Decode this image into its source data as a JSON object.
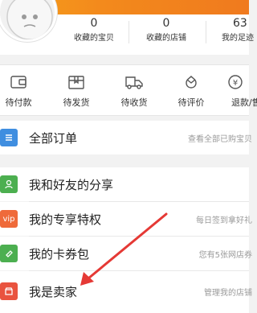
{
  "stats": [
    {
      "value": "0",
      "label": "收藏的宝贝"
    },
    {
      "value": "0",
      "label": "收藏的店铺"
    },
    {
      "value": "63",
      "label": "我的足迹"
    }
  ],
  "orders": [
    {
      "label": "待付款",
      "icon": "wallet-icon"
    },
    {
      "label": "待发货",
      "icon": "package-icon"
    },
    {
      "label": "待收货",
      "icon": "truck-icon"
    },
    {
      "label": "待评价",
      "icon": "review-icon"
    },
    {
      "label": "退款/售后",
      "icon": "refund-icon"
    }
  ],
  "all_orders": {
    "title": "全部订单",
    "hint": "查看全部已购宝贝"
  },
  "menu": [
    {
      "title": "我和好友的分享",
      "hint": "",
      "badge": "",
      "color": "#4caf50"
    },
    {
      "title": "我的专享特权",
      "hint": "每日签到拿好礼",
      "badge": "vip",
      "color": "#ef6a3a"
    },
    {
      "title": "我的卡券包",
      "hint": "您有5张网店券",
      "badge": "",
      "color": "#4caf50"
    },
    {
      "title": "我是卖家",
      "hint": "管理我的店铺",
      "badge": "",
      "color": "#e9533f"
    }
  ],
  "colors": {
    "orange": "#f38a1c",
    "blue": "#3f8ee0",
    "green": "#4caf50",
    "red": "#e9533f",
    "arrow": "#e53935"
  }
}
